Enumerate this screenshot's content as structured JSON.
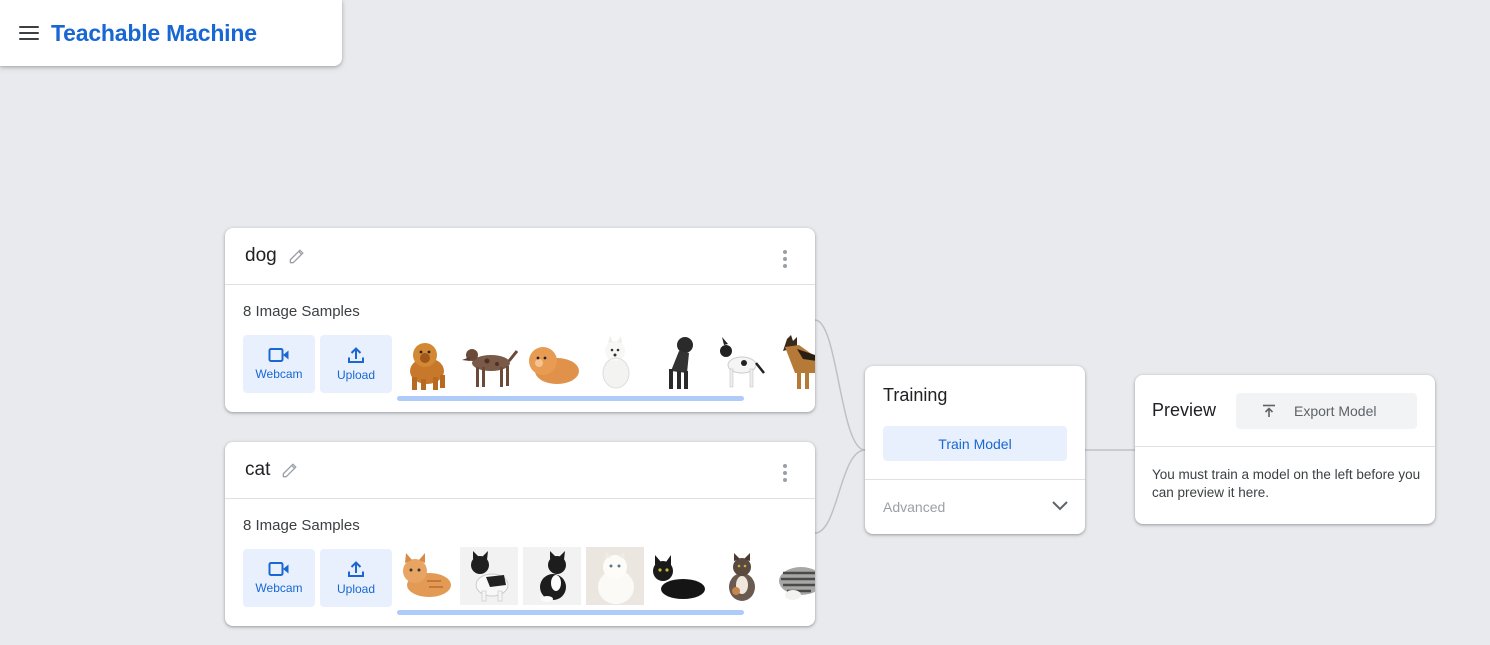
{
  "app": {
    "title": "Teachable Machine"
  },
  "classes": [
    {
      "name": "dog",
      "samples_label": "8 Image Samples",
      "webcam_label": "Webcam",
      "upload_label": "Upload",
      "thumbnails": [
        "chow-chow-dog",
        "spotted-mixed-dog",
        "pomeranian-dog",
        "samoyed-dog",
        "black-labrador-dog",
        "black-white-dog",
        "german-shepherd-dog"
      ]
    },
    {
      "name": "cat",
      "samples_label": "8 Image Samples",
      "webcam_label": "Webcam",
      "upload_label": "Upload",
      "thumbnails": [
        "orange-tabby-cat",
        "black-white-cat",
        "tuxedo-cat",
        "white-persian-cat",
        "black-cat",
        "calico-cat",
        "silver-tabby-cat"
      ]
    }
  ],
  "training": {
    "title": "Training",
    "train_button": "Train Model",
    "advanced_label": "Advanced"
  },
  "preview": {
    "title": "Preview",
    "export_button": "Export Model",
    "message": "You must train a model on the left before you can preview it here."
  },
  "colors": {
    "accent": "#1967d2",
    "accent_light": "#e8f0fe",
    "background": "#e8eaed",
    "scrollbar": "#aecbfa"
  },
  "icons": [
    "menu-icon",
    "pencil-icon",
    "more-vert-icon",
    "videocam-icon",
    "upload-icon",
    "chevron-down-icon",
    "export-icon"
  ]
}
